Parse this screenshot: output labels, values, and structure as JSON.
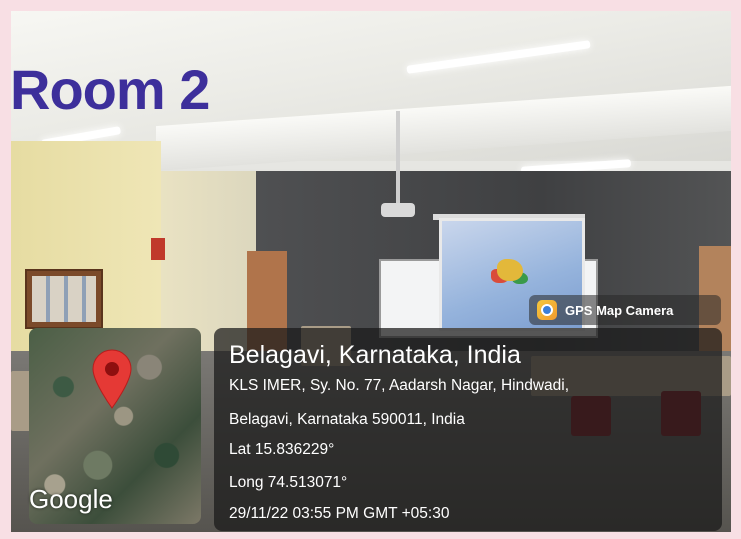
{
  "overlay_label": "Room 2",
  "gps_badge": {
    "label": "GPS Map Camera",
    "icon": "gps-map-camera-app-icon"
  },
  "map": {
    "pin_icon": "map-pin-icon",
    "attribution": "Google"
  },
  "location": {
    "title": "Belagavi, Karnataka, India",
    "address_line1": "KLS IMER, Sy. No. 77, Aadarsh Nagar, Hindwadi,",
    "address_line2": "Belagavi, Karnataka 590011, India",
    "lat": "Lat 15.836229°",
    "long": "Long 74.513071°",
    "datetime": "29/11/22 03:55 PM GMT +05:30"
  },
  "colors": {
    "page_border": "#f8dfe4",
    "label_color": "#3d2f9b",
    "pin_red": "#e53935"
  }
}
